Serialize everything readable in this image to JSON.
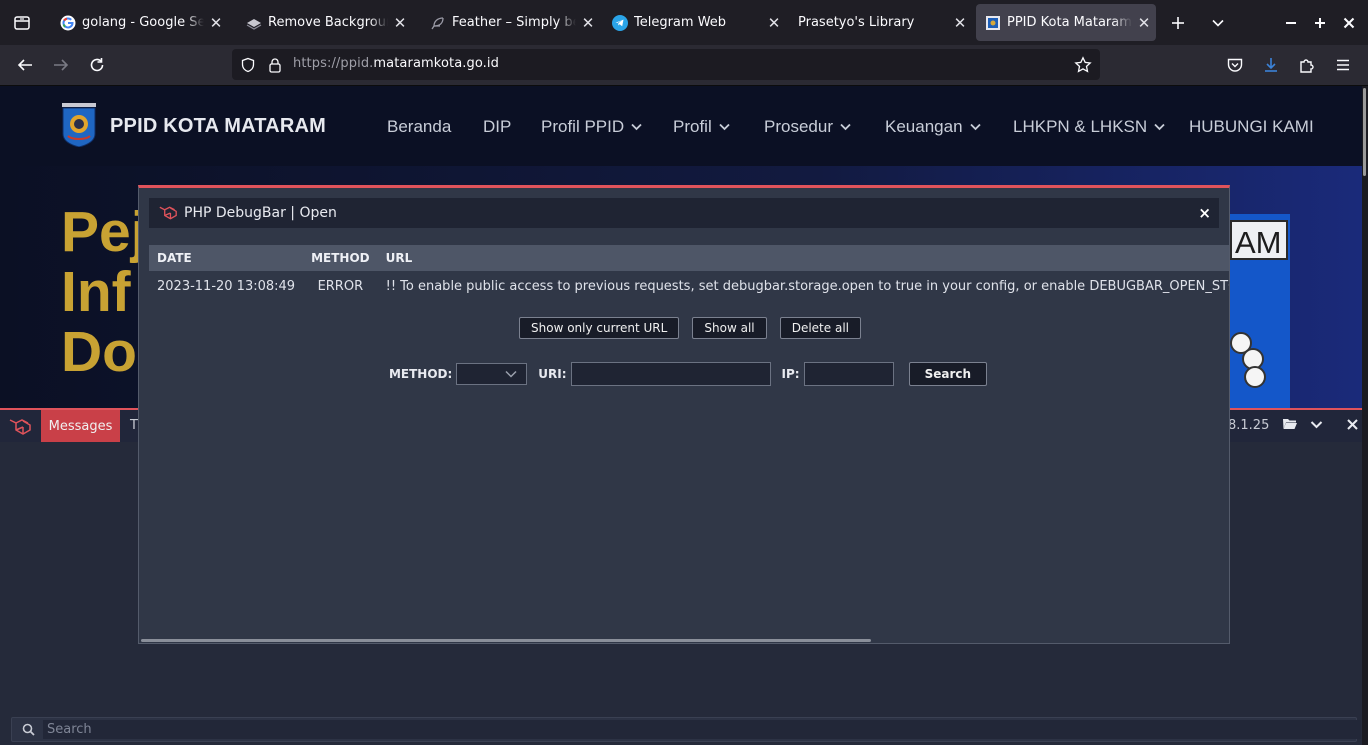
{
  "browser": {
    "tabs": [
      {
        "title": "golang - Google Search",
        "icon": "google-icon"
      },
      {
        "title": "Remove Background from Image",
        "icon": "layers-icon"
      },
      {
        "title": "Feather – Simply beautiful open source icons",
        "icon": "feather-icon"
      },
      {
        "title": "Telegram Web",
        "icon": "telegram-icon"
      },
      {
        "title": "Prasetyo's Library",
        "icon": ""
      },
      {
        "title": "PPID Kota Mataram",
        "icon": "site-logo-icon",
        "active": true
      }
    ],
    "url_prefix": "https://ppid.",
    "url_domain": "mataramkota.go.id"
  },
  "site": {
    "name": "PPID KOTA MATARAM",
    "nav": [
      {
        "label": "Beranda"
      },
      {
        "label": "DIP"
      },
      {
        "label": "Profil PPID",
        "dropdown": true
      },
      {
        "label": "Profil",
        "dropdown": true
      },
      {
        "label": "Prosedur",
        "dropdown": true
      },
      {
        "label": "Keuangan",
        "dropdown": true
      },
      {
        "label": "LHKPN & LHKSN",
        "dropdown": true
      },
      {
        "label": "HUBUNGI KAMI"
      }
    ],
    "hero_lines": [
      "Pej",
      "Inf",
      "Do"
    ],
    "sign_text": "AM"
  },
  "debugbar": {
    "tab_active": "Messages",
    "tab_next": "T",
    "version": "8.1.25",
    "search_placeholder": "Search",
    "accent": "#e0535b"
  },
  "modal": {
    "title": "PHP DebugBar | Open",
    "close": "×",
    "columns": [
      "DATE",
      "METHOD",
      "URL"
    ],
    "rows": [
      {
        "date": "2023-11-20 13:08:49",
        "method": "ERROR",
        "url": "!! To enable public access to previous requests, set debugbar.storage.open to true in your config, or enable DEBUGBAR_OPEN_STORAGE if you have no config."
      }
    ],
    "buttons": {
      "current_url": "Show only current URL",
      "show_all": "Show all",
      "delete_all": "Delete all"
    },
    "filter": {
      "method_label": "METHOD:",
      "method_value": "",
      "uri_label": "URI:",
      "ip_label": "IP:",
      "search_button": "Search"
    }
  }
}
